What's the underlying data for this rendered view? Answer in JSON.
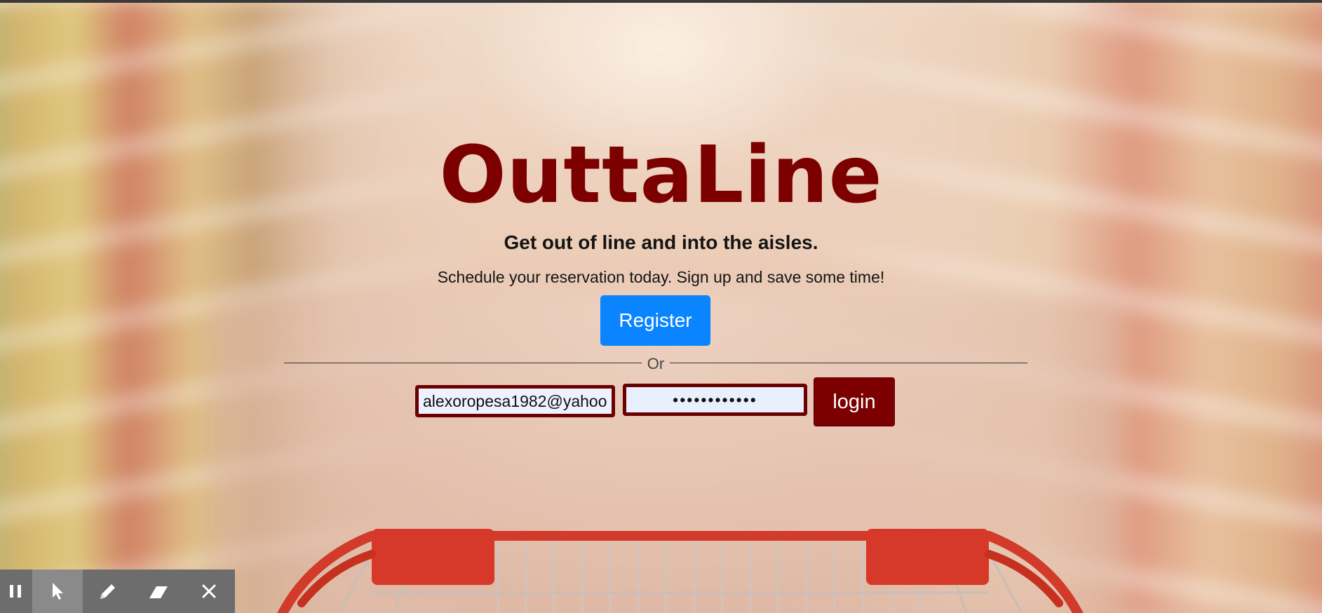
{
  "app": {
    "title": "OuttaLine"
  },
  "hero": {
    "brand": "OuttaLine",
    "tagline": "Get out of line and into the aisles.",
    "subtagline": "Schedule your reservation today. Sign up and save some time!",
    "register_label": "Register",
    "divider_label": "Or"
  },
  "login": {
    "email_value": "alexoropesa1982@yahoo",
    "password_value": "••••••••••••",
    "login_label": "login"
  },
  "colors": {
    "brand": "#7c0000",
    "register": "#0a84ff",
    "login": "#7c0000"
  },
  "toolbar": {
    "tools": [
      "pause-icon",
      "pointer-icon",
      "pen-icon",
      "eraser-icon",
      "close-icon"
    ]
  }
}
